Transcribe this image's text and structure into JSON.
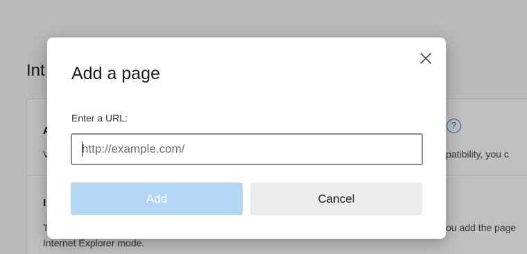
{
  "background": {
    "heading": "Int",
    "card": {
      "row1_title": "A",
      "row1_desc_left": "V",
      "row1_desc_right": "patibility, you c",
      "row2_title": "I",
      "row2_desc_left": "T",
      "row2_desc_right": "ou add the page",
      "row2_desc_line2": "Internet Explorer mode.",
      "help_icon": "?"
    }
  },
  "dialog": {
    "title": "Add a page",
    "url_label": "Enter a URL:",
    "url_input": {
      "value": "",
      "placeholder": "http://example.com/"
    },
    "add_label": "Add",
    "cancel_label": "Cancel"
  },
  "colors": {
    "add_button_disabled": "#b3d6f5",
    "cancel_button": "#ececec",
    "help_icon_blue": "#2b6ad1"
  }
}
